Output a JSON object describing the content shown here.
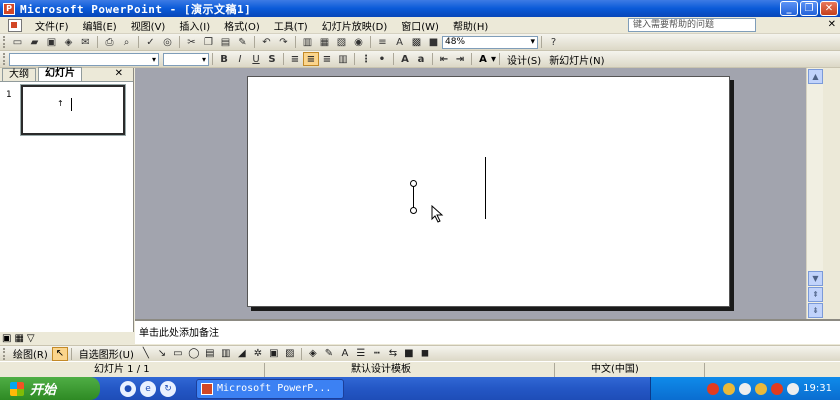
{
  "window": {
    "title": "Microsoft PowerPoint - [演示文稿1]",
    "app_icon": "P"
  },
  "menus": [
    "文件(F)",
    "编辑(E)",
    "视图(V)",
    "插入(I)",
    "格式(O)",
    "工具(T)",
    "幻灯片放映(D)",
    "窗口(W)",
    "帮助(H)"
  ],
  "help_search_placeholder": "键入需要帮助的问题",
  "toolbar": {
    "zoom": "48%",
    "font_size": "",
    "design_label": "设计(S)",
    "new_slide_label": "新幻灯片(N)"
  },
  "left_pane": {
    "tabs": [
      "大纲",
      "幻灯片"
    ],
    "active_tab": "幻灯片",
    "slide_number": "1"
  },
  "notes_placeholder": "单击此处添加备注",
  "drawing_toolbar": {
    "draw_label": "绘图(R)",
    "autoshapes_label": "自选图形(U)"
  },
  "status": {
    "slide_info": "幻灯片 1 / 1",
    "template": "默认设计模板",
    "language": "中文(中国)"
  },
  "taskbar": {
    "start_label": "开始",
    "task_item": "Microsoft PowerP...",
    "clock": "19:31"
  },
  "colors": {
    "title_bar": "#0a5ad8",
    "slide_area_bg": "#a2a4ae",
    "taskbar": "#2457c5",
    "start_button": "#2e8a24"
  }
}
